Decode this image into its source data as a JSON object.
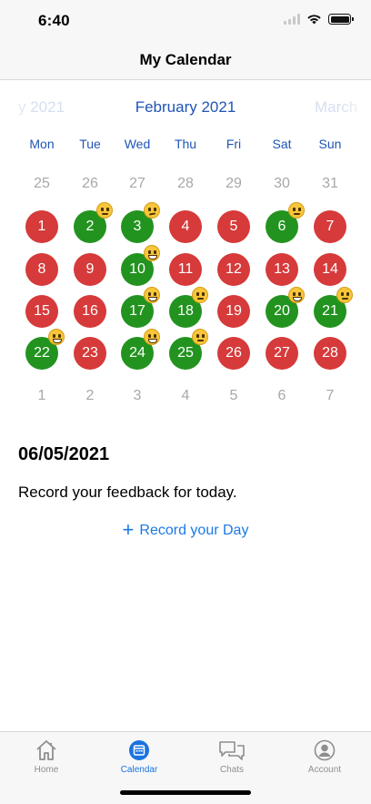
{
  "status_bar": {
    "time": "6:40"
  },
  "nav": {
    "title": "My Calendar"
  },
  "calendar": {
    "prev_month": "y 2021",
    "current_month": "February 2021",
    "next_month": "March",
    "weekdays": [
      "Mon",
      "Tue",
      "Wed",
      "Thu",
      "Fri",
      "Sat",
      "Sun"
    ],
    "rows": [
      [
        {
          "d": "25",
          "s": "muted"
        },
        {
          "d": "26",
          "s": "muted"
        },
        {
          "d": "27",
          "s": "muted"
        },
        {
          "d": "28",
          "s": "muted"
        },
        {
          "d": "29",
          "s": "muted"
        },
        {
          "d": "30",
          "s": "muted"
        },
        {
          "d": "31",
          "s": "muted"
        }
      ],
      [
        {
          "d": "1",
          "s": "red"
        },
        {
          "d": "2",
          "s": "green",
          "e": "neutral"
        },
        {
          "d": "3",
          "s": "green",
          "e": "sad"
        },
        {
          "d": "4",
          "s": "red"
        },
        {
          "d": "5",
          "s": "red"
        },
        {
          "d": "6",
          "s": "green",
          "e": "neutral"
        },
        {
          "d": "7",
          "s": "red"
        }
      ],
      [
        {
          "d": "8",
          "s": "red"
        },
        {
          "d": "9",
          "s": "red"
        },
        {
          "d": "10",
          "s": "green",
          "e": "smile"
        },
        {
          "d": "11",
          "s": "red"
        },
        {
          "d": "12",
          "s": "red"
        },
        {
          "d": "13",
          "s": "red"
        },
        {
          "d": "14",
          "s": "red"
        }
      ],
      [
        {
          "d": "15",
          "s": "red"
        },
        {
          "d": "16",
          "s": "red"
        },
        {
          "d": "17",
          "s": "green",
          "e": "smile"
        },
        {
          "d": "18",
          "s": "green",
          "e": "neutral"
        },
        {
          "d": "19",
          "s": "red"
        },
        {
          "d": "20",
          "s": "green",
          "e": "smile"
        },
        {
          "d": "21",
          "s": "green",
          "e": "neutral"
        }
      ],
      [
        {
          "d": "22",
          "s": "green",
          "e": "smile"
        },
        {
          "d": "23",
          "s": "red"
        },
        {
          "d": "24",
          "s": "green",
          "e": "smile"
        },
        {
          "d": "25",
          "s": "green",
          "e": "neutral"
        },
        {
          "d": "26",
          "s": "red"
        },
        {
          "d": "27",
          "s": "red"
        },
        {
          "d": "28",
          "s": "red"
        }
      ],
      [
        {
          "d": "1",
          "s": "muted"
        },
        {
          "d": "2",
          "s": "muted"
        },
        {
          "d": "3",
          "s": "muted"
        },
        {
          "d": "4",
          "s": "muted"
        },
        {
          "d": "5",
          "s": "muted"
        },
        {
          "d": "6",
          "s": "muted"
        },
        {
          "d": "7",
          "s": "muted"
        }
      ]
    ]
  },
  "feedback": {
    "date": "06/05/2021",
    "prompt": "Record your feedback for today.",
    "record_label": "Record your Day"
  },
  "tabs": [
    {
      "label": "Home",
      "icon": "home-icon"
    },
    {
      "label": "Calendar",
      "icon": "calendar-icon"
    },
    {
      "label": "Chats",
      "icon": "chats-icon"
    },
    {
      "label": "Account",
      "icon": "account-icon"
    }
  ],
  "colors": {
    "accent": "#1a73e0",
    "month_label": "#1f55b5",
    "bad_day": "#d63a3a",
    "good_day": "#22931f"
  }
}
